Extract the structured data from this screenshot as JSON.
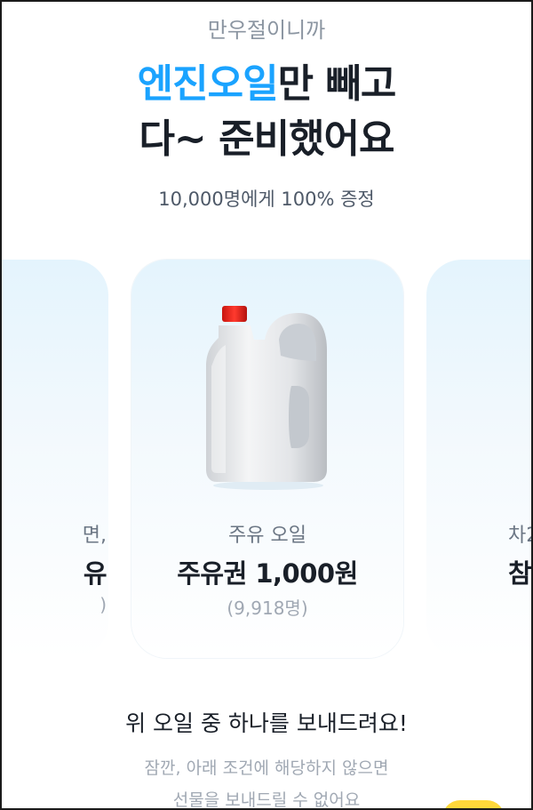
{
  "header": {
    "subtitle": "만우절이니까",
    "headline_accent": "엔진오일",
    "headline_rest": "만 빼고",
    "headline_line2": "다~ 준비했어요",
    "count_line": "10,000명에게 100% 증정"
  },
  "carousel": {
    "left_card": {
      "label": "면,",
      "title": "유",
      "count": ")"
    },
    "center_card": {
      "icon": "oil-jug-icon",
      "label": "주유 오일",
      "title": "주유권 1,000원",
      "count": "(9,918명)"
    },
    "right_card": {
      "label": "차2",
      "title": "참"
    }
  },
  "footer": {
    "notice": "위 오일 중 하나를 보내드려요!",
    "sub_notice_line1": "잠깐, 아래 조건에 해당하지 않으면",
    "sub_notice_line2": "선물을 보내드릴 수 없어요"
  },
  "colors": {
    "accent": "#1aa3ff",
    "text_primary": "#191f28",
    "text_secondary": "#8b95a1",
    "card_bg_top": "#e4f4fd",
    "cap_red": "#e8221b",
    "badge_yellow": "#ffd83a"
  }
}
